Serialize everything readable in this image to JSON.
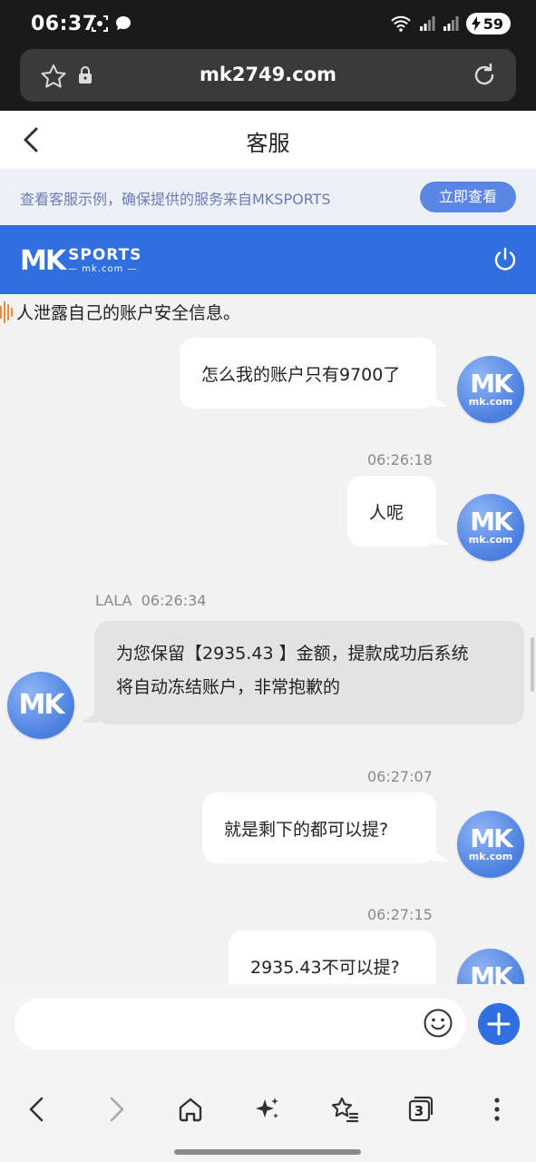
{
  "status_bar": {
    "time": "06:37",
    "battery": "59"
  },
  "browser": {
    "url": "mk2749.com"
  },
  "header": {
    "title": "客服"
  },
  "notice": {
    "text": "查看客服示例，确保提供的服务来自MKSPORTS",
    "button_label": "立即查看"
  },
  "brand": {
    "logo_mk": "MK",
    "logo_sports": "SPORTS",
    "logo_domain": "— mk.com —"
  },
  "avatar": {
    "mk": "MK",
    "domain": "mk.com"
  },
  "chat": {
    "top_snippet": "人泄露自己的账户安全信息。",
    "messages": [
      {
        "side": "right",
        "time": "",
        "text": "怎么我的账户只有9700了"
      },
      {
        "side": "right",
        "time": "06:26:18",
        "text": "人呢"
      },
      {
        "side": "left",
        "sender": "LALA",
        "time": "06:26:34",
        "line1": "为您保留【2935.43 】金额，提款成功后系统",
        "line2": "将自动冻结账户，非常抱歉的"
      },
      {
        "side": "right",
        "time": "06:27:07",
        "text": "就是剩下的都可以提?"
      },
      {
        "side": "right",
        "time": "06:27:15",
        "text": "2935.43不可以提?"
      }
    ]
  },
  "bottom_nav": {
    "tab_count": "3"
  },
  "colors": {
    "brand_blue": "#2f6fe0",
    "notice_button": "#5b86e5"
  }
}
